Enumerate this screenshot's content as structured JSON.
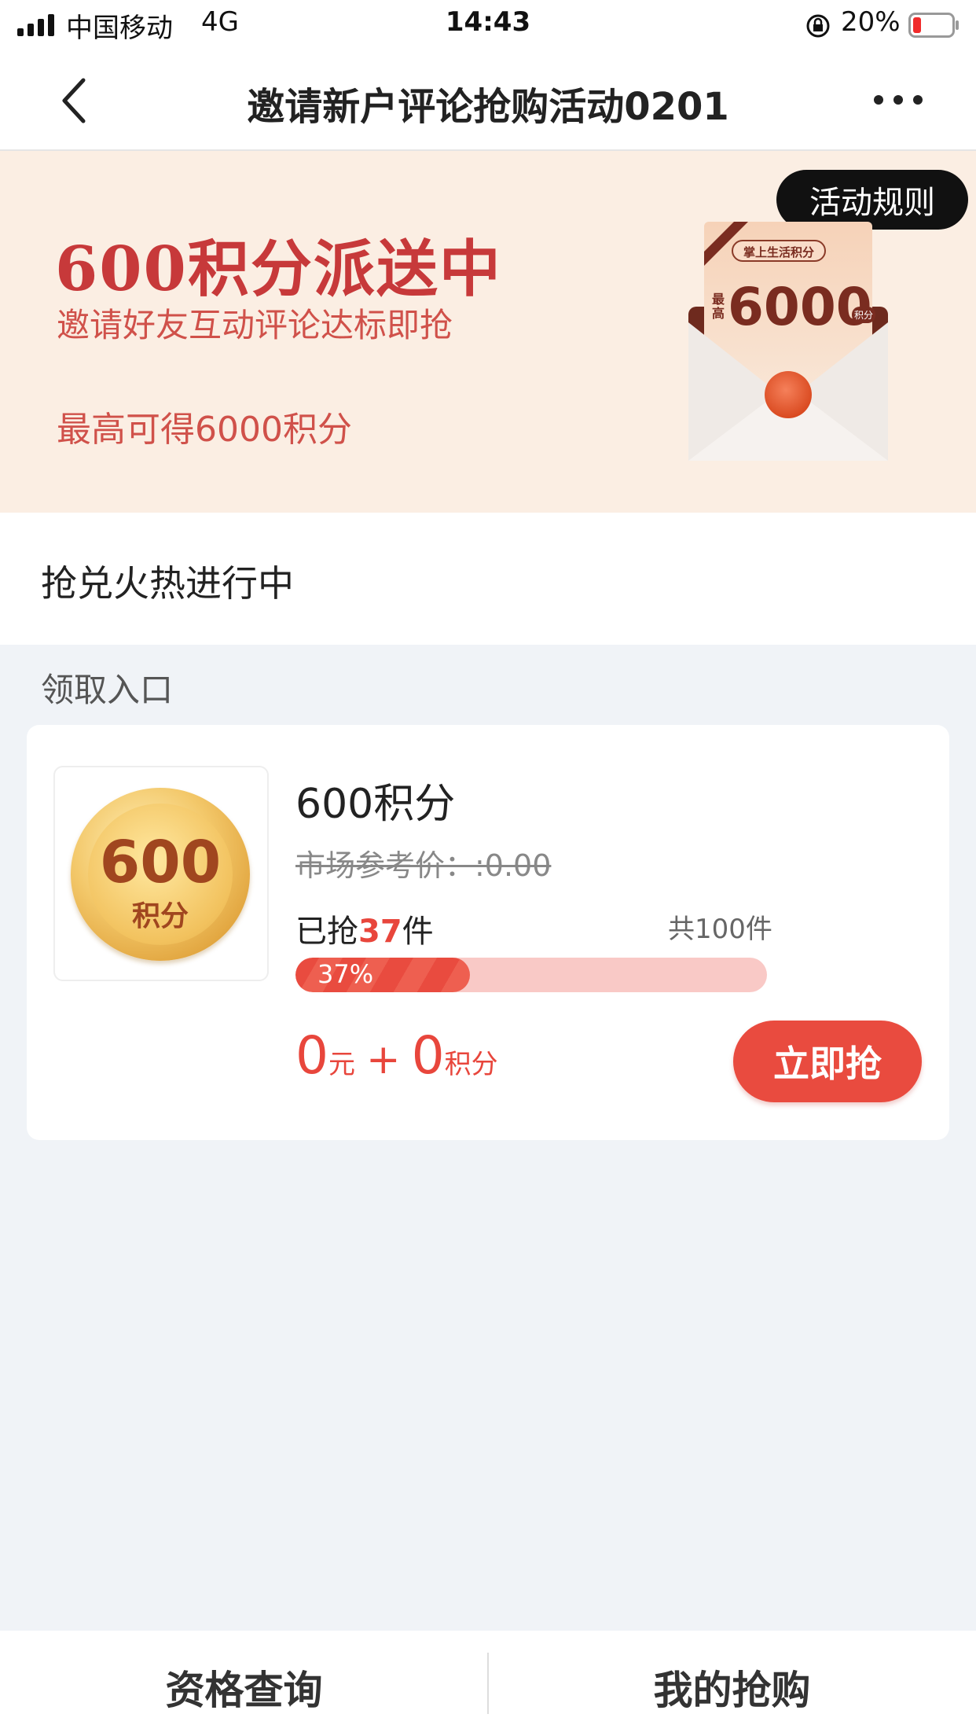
{
  "status_bar": {
    "carrier": "中国移动",
    "network": "4G",
    "time": "14:43",
    "battery": "20%"
  },
  "nav": {
    "title": "邀请新户评论抢购活动0201"
  },
  "banner": {
    "headline": "600积分派送中",
    "subline": "邀请好友互动评论达标即抢",
    "max_text": "最高可得6000积分",
    "rules_button": "活动规则",
    "envelope_tag": "掌上生活积分",
    "envelope_prefix": "最高",
    "envelope_amount": "6000",
    "envelope_unit": "积分"
  },
  "section": {
    "title": "抢兑火热进行中",
    "entry_label": "领取入口"
  },
  "product": {
    "badge_number": "600",
    "badge_unit": "积分",
    "title": "600积分",
    "market_price": "市场参考价：:0.00",
    "sold_prefix": "已抢",
    "sold_count": "37",
    "sold_suffix": "件",
    "total": "共100件",
    "progress": 0.37,
    "progress_label": "37%",
    "price_yuan": "0",
    "price_yuan_unit": "元",
    "plus": "+",
    "price_points": "0",
    "price_points_unit": "积分",
    "buy_button": "立即抢"
  },
  "tabbar": {
    "left": "资格查询",
    "right": "我的抢购"
  },
  "colors": {
    "accent": "#e94b3f",
    "banner_bg": "#fbeee3",
    "page_bg": "#f0f3f7"
  }
}
